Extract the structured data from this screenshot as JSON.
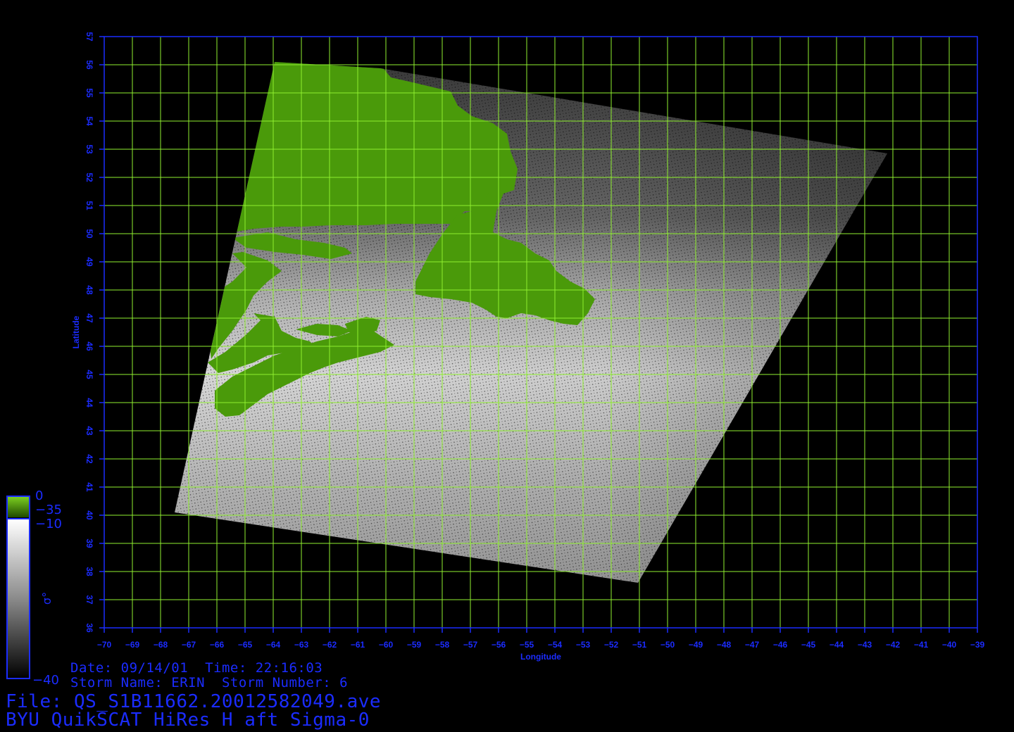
{
  "info": {
    "date_label": "Date:",
    "date": "09/14/01",
    "time_label": "Time:",
    "time": "22:16:03",
    "storm_name_label": "Storm Name:",
    "storm_name": "ERIN",
    "storm_number_label": "Storm Number:",
    "storm_number": "6",
    "file_label": "File:",
    "file": "QS_S1B11662.20012582049.ave",
    "product": "BYU QuikSCAT HiRes H aft Sigma-0"
  },
  "axes": {
    "xlabel": "Longitude",
    "ylabel": "Latitude",
    "xlim": [
      -70,
      -39
    ],
    "ylim": [
      36,
      57
    ],
    "x_ticks": [
      -70,
      -69,
      -68,
      -67,
      -66,
      -65,
      -64,
      -63,
      -62,
      -61,
      -60,
      -59,
      -58,
      -57,
      -56,
      -55,
      -54,
      -53,
      -52,
      -51,
      -50,
      -49,
      -48,
      -47,
      -46,
      -45,
      -44,
      -43,
      -42,
      -41,
      -40,
      -39
    ],
    "y_ticks": [
      36,
      37,
      38,
      39,
      40,
      41,
      42,
      43,
      44,
      45,
      46,
      47,
      48,
      49,
      50,
      51,
      52,
      53,
      54,
      55,
      56,
      57
    ],
    "grid": true
  },
  "colorbar": {
    "symbol": "σ°",
    "land_max": "0",
    "land_min": "−35",
    "ocean_max": "−10",
    "ocean_min": "−40"
  },
  "colors": {
    "axis": "#1b2cff",
    "grid": "#8fef2f",
    "land": "#4a9a0a",
    "text": "#1b2cff"
  }
}
